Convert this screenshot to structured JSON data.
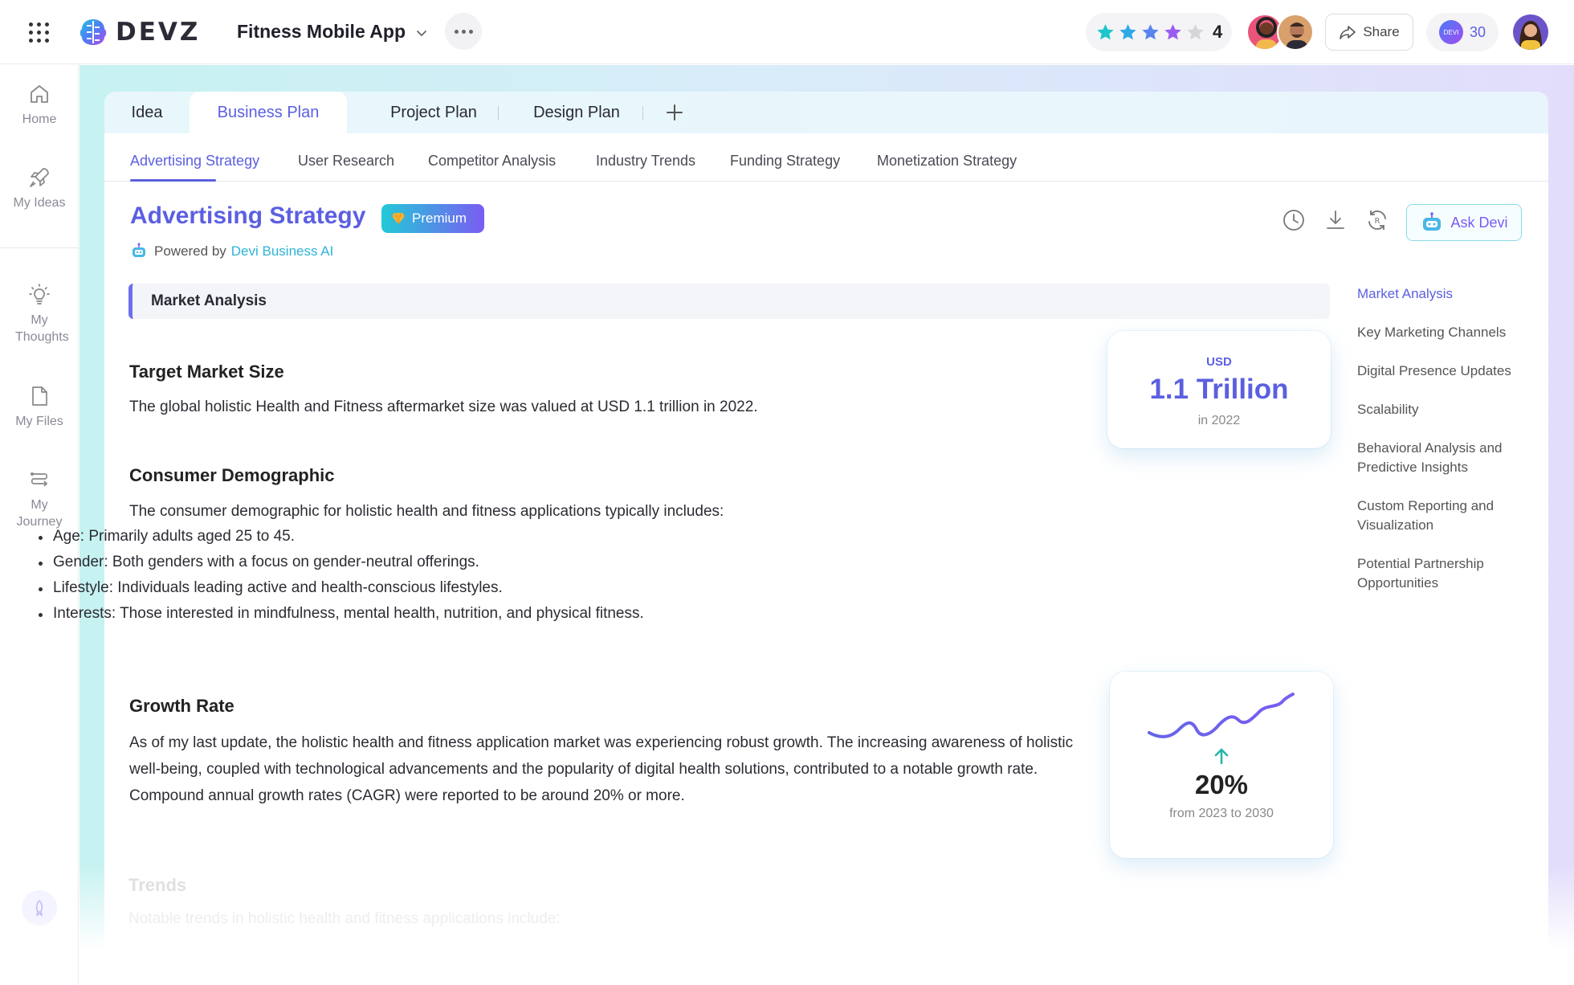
{
  "header": {
    "logo_text": "DEVZ",
    "project_title": "Fitness Mobile App",
    "rating_value": "4",
    "rating_stars_filled": 4,
    "rating_stars_total": 5,
    "share_label": "Share",
    "credits_label": "DEVI",
    "credits_value": "30"
  },
  "sidebar": {
    "items": [
      {
        "label": "Home",
        "icon": "home-icon"
      },
      {
        "label": "My Ideas",
        "icon": "rocket-icon"
      },
      {
        "label": "My Thoughts",
        "icon": "lightbulb-icon"
      },
      {
        "label": "My Files",
        "icon": "file-icon"
      },
      {
        "label": "My Journey",
        "icon": "route-icon"
      }
    ]
  },
  "tabs": [
    {
      "label": "Idea"
    },
    {
      "label": "Business Plan",
      "active": true
    },
    {
      "label": "Project Plan"
    },
    {
      "label": "Design Plan"
    }
  ],
  "subtabs": [
    {
      "label": "Advertising Strategy",
      "active": true
    },
    {
      "label": "User Research"
    },
    {
      "label": "Competitor Analysis"
    },
    {
      "label": "Industry Trends"
    },
    {
      "label": "Funding Strategy"
    },
    {
      "label": "Monetization Strategy"
    }
  ],
  "content": {
    "title": "Advertising Strategy",
    "premium_label": "Premium",
    "powered_prefix": "Powered by",
    "powered_link": "Devi Business AI",
    "ask_devi_label": "Ask Devi",
    "section_banner": "Market Analysis",
    "target_heading": "Target Market Size",
    "target_text": "The global holistic Health and Fitness aftermarket size was valued at USD 1.1 trillion in 2022.",
    "demographic_heading": "Consumer Demographic",
    "demographic_intro": "The consumer demographic for holistic health and fitness applications typically includes:",
    "demographic_bullets": [
      "Age: Primarily adults aged 25 to 45.",
      "Gender: Both genders with a focus on gender-neutral offerings.",
      "Lifestyle: Individuals leading active and health-conscious lifestyles.",
      "Interests: Those interested in mindfulness, mental health, nutrition, and physical fitness."
    ],
    "growth_heading": "Growth Rate",
    "growth_text": "As of my last update, the holistic health and fitness application market was experiencing robust growth. The increasing awareness of holistic well-being, coupled with technological advancements and the popularity of digital health solutions, contributed to a notable growth rate. Compound annual growth rates (CAGR) were reported to be around 20% or more.",
    "trends_heading": "Trends",
    "trends_intro": "Notable trends in holistic health and fitness applications include:"
  },
  "stat_market": {
    "currency": "USD",
    "value": "1.1 Trillion",
    "period": "in 2022"
  },
  "stat_growth": {
    "value": "20%",
    "period": "from 2023 to 2030"
  },
  "toc": [
    {
      "label": "Market Analysis",
      "active": true
    },
    {
      "label": "Key Marketing Channels"
    },
    {
      "label": "Digital Presence Updates"
    },
    {
      "label": "Scalability"
    },
    {
      "label": "Behavioral Analysis and Predictive Insights"
    },
    {
      "label": "Custom Reporting and Visualization"
    },
    {
      "label": "Potential Partnership Opportunities"
    }
  ],
  "colors": {
    "accent": "#5b5fe0",
    "teal": "#22c9d8",
    "purple": "#7a5cf2"
  }
}
